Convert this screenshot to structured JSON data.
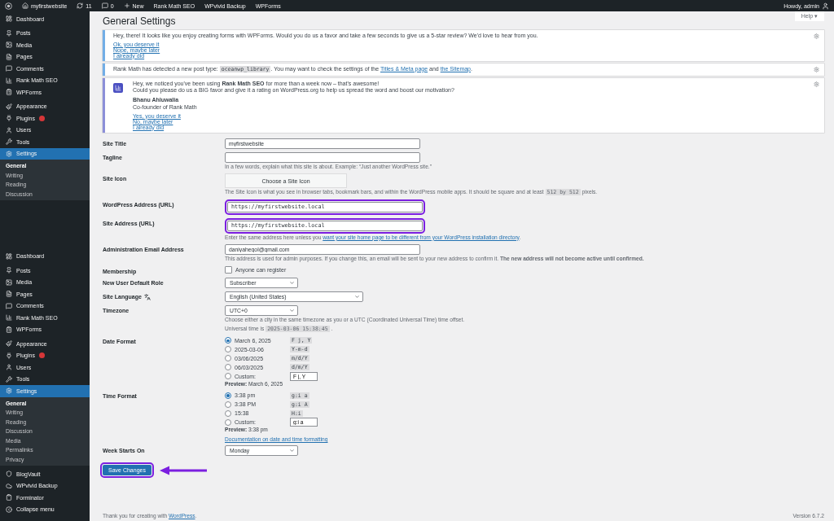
{
  "admin_bar": {
    "site": "myfirstwebsite",
    "updates": "11",
    "comments": "0",
    "items": [
      "New",
      "Rank Math SEO",
      "WPvivid Backup",
      "WPForms"
    ],
    "greeting": "Howdy, admin"
  },
  "sidebar_sections": [
    {
      "groups": [
        [
          {
            "label": "Dashboard"
          }
        ],
        [
          {
            "label": "Posts"
          },
          {
            "label": "Media"
          },
          {
            "label": "Pages"
          },
          {
            "label": "Comments"
          },
          {
            "label": "Rank Math SEO"
          },
          {
            "label": "WPForms"
          }
        ],
        [
          {
            "label": "Appearance"
          },
          {
            "label": "Plugins",
            "badge": true
          },
          {
            "label": "Users"
          },
          {
            "label": "Tools"
          },
          {
            "label": "Settings",
            "selected": true,
            "children": [
              {
                "label": "General",
                "selected": true
              },
              {
                "label": "Writing",
                "selected": false
              },
              {
                "label": "Reading",
                "selected": false
              },
              {
                "label": "Discussion",
                "selected": false
              }
            ]
          }
        ]
      ]
    },
    {
      "groups": [
        [
          {
            "label": "Dashboard"
          }
        ],
        [
          {
            "label": "Posts"
          },
          {
            "label": "Media"
          },
          {
            "label": "Pages"
          },
          {
            "label": "Comments"
          },
          {
            "label": "Rank Math SEO"
          },
          {
            "label": "WPForms"
          }
        ],
        [
          {
            "label": "Appearance"
          },
          {
            "label": "Plugins",
            "badge": true
          },
          {
            "label": "Users"
          },
          {
            "label": "Tools"
          },
          {
            "label": "Settings",
            "selected": true,
            "children": [
              {
                "label": "General",
                "selected": true
              },
              {
                "label": "Writing",
                "selected": false
              },
              {
                "label": "Reading",
                "selected": false
              },
              {
                "label": "Discussion",
                "selected": false
              },
              {
                "label": "Media",
                "selected": false
              },
              {
                "label": "Permalinks",
                "selected": false
              },
              {
                "label": "Privacy",
                "selected": false
              }
            ]
          }
        ],
        [
          {
            "label": "BlogVault"
          },
          {
            "label": "WPvivid Backup"
          },
          {
            "label": "Forminator"
          },
          {
            "label": "Collapse menu"
          }
        ]
      ]
    }
  ],
  "page_title": "General Settings",
  "help": "Help ▾",
  "notices": [
    {
      "kind": "plain",
      "lines": [
        "Hey, there! It looks like you enjoy creating forms with WPForms. Would you do us a favor and take a few seconds to give us a 5-star review? We'd love to hear from you."
      ],
      "links": [
        "Ok, you deserve it",
        "Nope, maybe later",
        "I already did"
      ]
    },
    {
      "kind": "parts",
      "parts": [
        {
          "kind": "text",
          "text": "Rank Math has detected a new post type: "
        },
        {
          "kind": "code",
          "text": "oceanwp_library"
        },
        {
          "kind": "text",
          "text": ". You may want to check the settings of the "
        },
        {
          "kind": "link",
          "text": "Titles & Meta page"
        },
        {
          "kind": "text",
          "text": " and "
        },
        {
          "kind": "link",
          "text": "the Sitemap"
        },
        {
          "kind": "text",
          "text": "."
        }
      ]
    },
    {
      "kind": "logo",
      "lines": [
        "Hey, we noticed you've been using **Rank Math SEO** for more than a week now – that's awesome!",
        "Could you please do us a BIG favor and give it a rating on WordPress.org to help us spread the word and boost our motivation?"
      ],
      "author": "Bhanu Ahluwalia",
      "role": "Co-founder of Rank Math",
      "links": [
        "Yes, you deserve it",
        "No, maybe later",
        "I already did"
      ]
    }
  ],
  "settings": [
    {
      "kind": "text",
      "label": "Site Title",
      "value": "myfirstwebsite",
      "highlighted": false
    },
    {
      "kind": "text",
      "label": "Tagline",
      "highlighted": false,
      "description": [
        {
          "kind": "text",
          "text": "In a few words, explain what this site is about. Example: “Just another WordPress site.”"
        }
      ]
    },
    {
      "kind": "button",
      "label": "Site Icon",
      "button": "Choose a Site Icon",
      "description": [
        {
          "kind": "text",
          "text": "The Site Icon is what you see in browser tabs, bookmark bars, and within the WordPress mobile apps. It should be square and at least "
        },
        {
          "kind": "code",
          "text": "512 by 512"
        },
        {
          "kind": "text",
          "text": " pixels."
        }
      ]
    },
    {
      "kind": "url",
      "label": "WordPress Address (URL)",
      "value": "https://myfirstwebsite.local",
      "highlighted": true
    },
    {
      "kind": "url",
      "label": "Site Address (URL)",
      "value": "https://myfirstwebsite.local",
      "highlighted": true,
      "description": [
        {
          "kind": "text",
          "text": "Enter the same address here unless you "
        },
        {
          "kind": "link",
          "text": "want your site home page to be different from your WordPress installation directory"
        },
        {
          "kind": "text",
          "text": "."
        }
      ]
    },
    {
      "kind": "text",
      "label": "Administration Email Address",
      "value": "daniyahegol@gmail.com",
      "highlighted": false,
      "description": [
        {
          "kind": "text",
          "text": "This address is used for admin purposes. If you change this, an email will be sent to your new address to confirm it. **The new address will not become active until confirmed.**"
        }
      ]
    },
    {
      "kind": "checkbox",
      "label": "Membership",
      "option": "Anyone can register",
      "checked": false
    },
    {
      "kind": "select",
      "label": "New User Default Role",
      "value": "Subscriber"
    },
    {
      "kind": "language",
      "label": "Site Language",
      "value": "English (United States)"
    },
    {
      "kind": "select",
      "label": "Timezone",
      "value": "UTC+0",
      "description": [
        {
          "kind": "text",
          "text": "Choose either a city in the same timezone as you or a UTC (Coordinated Universal Time) time offset."
        }
      ],
      "extra": [
        {
          "kind": "text",
          "text": "Universal time is "
        },
        {
          "kind": "code",
          "text": "2025-03-06 15:38:45"
        },
        {
          "kind": "text",
          "text": " ."
        }
      ]
    },
    {
      "kind": "radios",
      "label": "Date Format",
      "options": [
        {
          "label": "March 6, 2025",
          "code": "F j, Y",
          "selected": true
        },
        {
          "label": "2025-03-06",
          "code": "Y-m-d",
          "selected": false
        },
        {
          "label": "03/06/2025",
          "code": "m/d/Y",
          "selected": false
        },
        {
          "label": "06/03/2025",
          "code": "d/m/Y",
          "selected": false
        },
        {
          "label": "Custom:",
          "custom": "F j, Y",
          "selected": false
        }
      ],
      "preview_label": "Preview:",
      "preview": "March 6, 2025"
    },
    {
      "kind": "radios",
      "label": "Time Format",
      "options": [
        {
          "label": "3:38 pm",
          "code": "g:i a",
          "selected": true
        },
        {
          "label": "3:38 PM",
          "code": "g:i A",
          "selected": false
        },
        {
          "label": "15:38",
          "code": "H:i",
          "selected": false
        },
        {
          "label": "Custom:",
          "custom": "g:i a",
          "selected": false
        }
      ],
      "preview_label": "Preview:",
      "preview": "3:38 pm",
      "link": "Documentation on date and time formatting"
    },
    {
      "kind": "select",
      "label": "Week Starts On",
      "value": "Monday"
    }
  ],
  "save": {
    "label": "Save Changes",
    "highlighted": true
  },
  "footer": {
    "parts": [
      {
        "kind": "text",
        "text": "Thank you for creating with "
      },
      {
        "kind": "link",
        "text": "WordPress"
      },
      {
        "kind": "text",
        "text": "."
      }
    ],
    "version": "Version 6.7.2"
  }
}
